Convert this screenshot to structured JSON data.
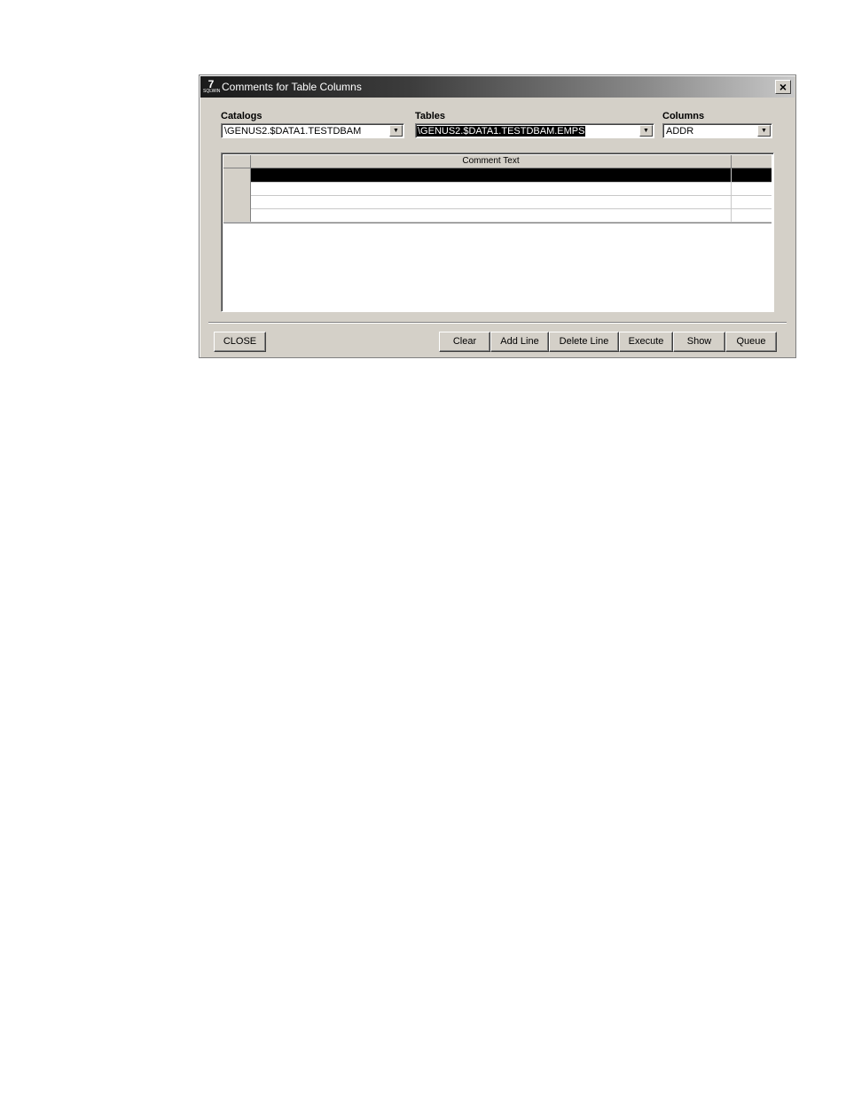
{
  "window": {
    "title": "Comments for Table Columns",
    "icon_label": "7",
    "icon_sublabel": "SQLWIN",
    "close_glyph": "×"
  },
  "selectors": {
    "catalogs": {
      "label": "Catalogs",
      "value": "\\GENUS2.$DATA1.TESTDBAM"
    },
    "tables": {
      "label": "Tables",
      "value": "\\GENUS2.$DATA1.TESTDBAM.EMPS"
    },
    "columns": {
      "label": "Columns",
      "value": "ADDR"
    }
  },
  "grid": {
    "header": "Comment Text",
    "rows": [
      "",
      "",
      "",
      ""
    ],
    "active_row": 0
  },
  "buttons": {
    "close": "CLOSE",
    "clear": "Clear",
    "add_line": "Add Line",
    "delete_line": "Delete Line",
    "execute": "Execute",
    "show": "Show",
    "queue": "Queue"
  },
  "icons": {
    "dropdown": "chevron-down-icon",
    "close": "close-icon",
    "app": "app-icon"
  }
}
